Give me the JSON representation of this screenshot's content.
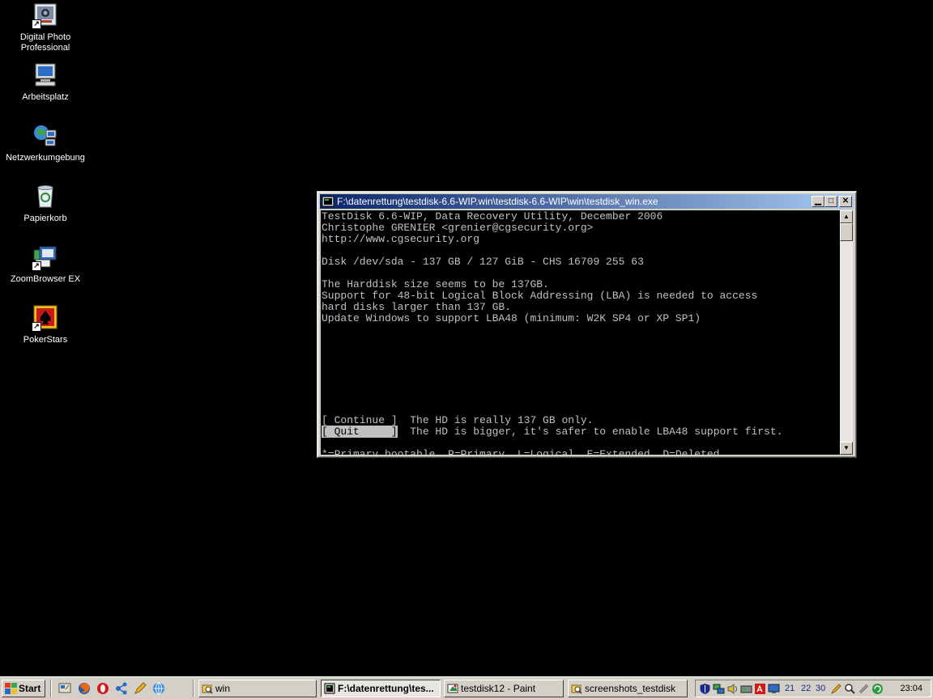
{
  "desktop": {
    "icons": [
      {
        "label_line1": "Digital Photo",
        "label_line2": "Professional",
        "icon": "camera-photo-icon"
      },
      {
        "label_line1": "Arbeitsplatz",
        "icon": "computer-icon"
      },
      {
        "label_line1": "Netzwerkumgebung",
        "icon": "network-icon"
      },
      {
        "label_line1": "Papierkorb",
        "icon": "recycle-bin-icon"
      },
      {
        "label_line1": "ZoomBrowser EX",
        "icon": "zoombrowser-icon"
      },
      {
        "label_line1": "PokerStars",
        "icon": "pokerstars-icon"
      }
    ]
  },
  "window": {
    "title": "F:\\datenrettung\\testdisk-6.6-WIP.win\\testdisk-6.6-WIP\\win\\testdisk_win.exe",
    "console": {
      "line1": "TestDisk 6.6-WIP, Data Recovery Utility, December 2006",
      "line2": "Christophe GRENIER <grenier@cgsecurity.org>",
      "line3": "http://www.cgsecurity.org",
      "disk": "Disk /dev/sda - 137 GB / 127 GiB - CHS 16709 255 63",
      "warn1": "The Harddisk size seems to be 137GB.",
      "warn2": "Support for 48-bit Logical Block Addressing (LBA) is needed to access",
      "warn3": "hard disks larger than 137 GB.",
      "warn4": "Update Windows to support LBA48 (minimum: W2K SP4 or XP SP1)",
      "opt_continue": "[ Continue ]",
      "opt_continue_desc": "  The HD is really 137 GB only.",
      "opt_quit": "[ Quit     ]",
      "opt_quit_desc": "  The HD is bigger, it's safer to enable LBA48 support first.",
      "legend": "*=Primary bootable  P=Primary  L=Logical  E=Extended  D=Deleted"
    }
  },
  "taskbar": {
    "start_label": "Start",
    "tasks": [
      {
        "label": "win"
      },
      {
        "label": "F:\\datenrettung\\tes..."
      },
      {
        "label": "testdisk12 - Paint"
      },
      {
        "label": "screenshots_testdisk"
      }
    ],
    "tray": {
      "date_nums": [
        "21",
        "22",
        "30"
      ],
      "clock": "23:04"
    }
  },
  "colors": {
    "desktop_bg": "#000000",
    "title_active_start": "#0a246a",
    "title_active_end": "#a6caf0",
    "console_fg": "#c0c0c0"
  }
}
